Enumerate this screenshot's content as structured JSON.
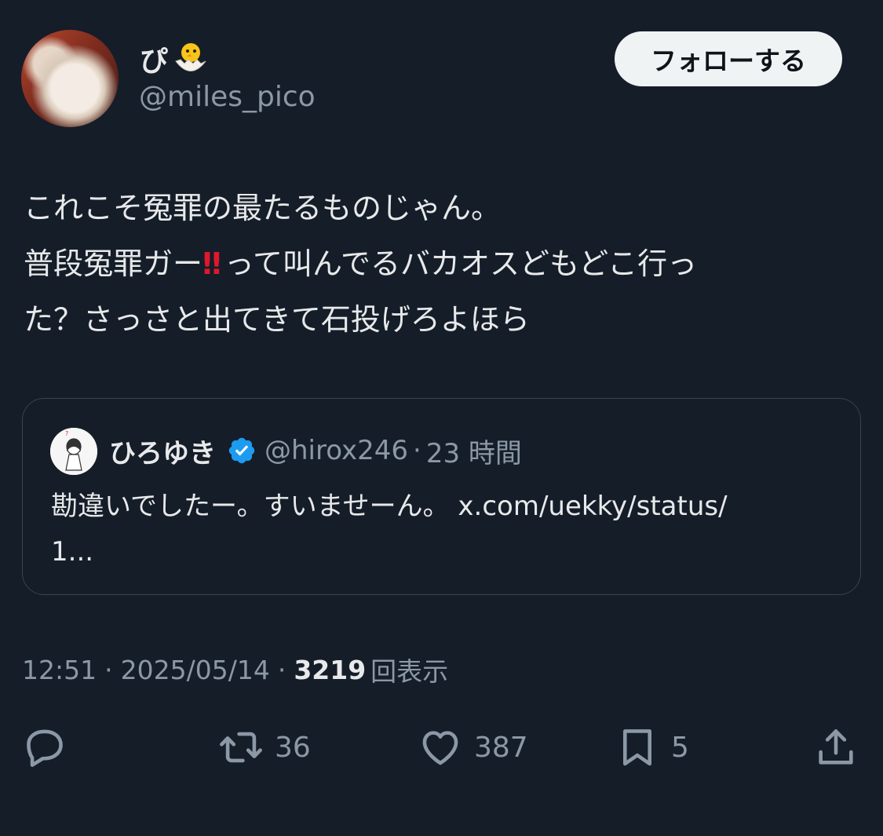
{
  "author": {
    "display_name": "ぴ",
    "name_emoji": "hatching-chick-icon",
    "handle": "@miles_pico"
  },
  "follow_label": "フォローする",
  "tweet_lines": [
    "これこそ冤罪の最たるものじゃん。",
    "普段冤罪ガー",
    "‼",
    "って叫んでるバカオスどもどこ行っ",
    "た？さっさと出てきて石投げろよほら"
  ],
  "quote": {
    "name": "ひろゆき",
    "handle": "@hirox246",
    "separator": "·",
    "time": "23 時間",
    "text_line1": "勘違いでしたー。すいませーん。 x.com/uekky/status/",
    "text_line2": "1..."
  },
  "meta": {
    "time": "12:51",
    "separator": "·",
    "date": "2025/05/14",
    "views_count": "3219",
    "views_label": "回表示"
  },
  "actions": {
    "reply_count": "",
    "retweet_count": "36",
    "like_count": "387",
    "bookmark_count": "5"
  },
  "colors": {
    "background": "#151d28",
    "text": "#e7e9ea",
    "secondary": "#8b98a5",
    "verified": "#1d9bf0",
    "alert": "#e0182d"
  }
}
